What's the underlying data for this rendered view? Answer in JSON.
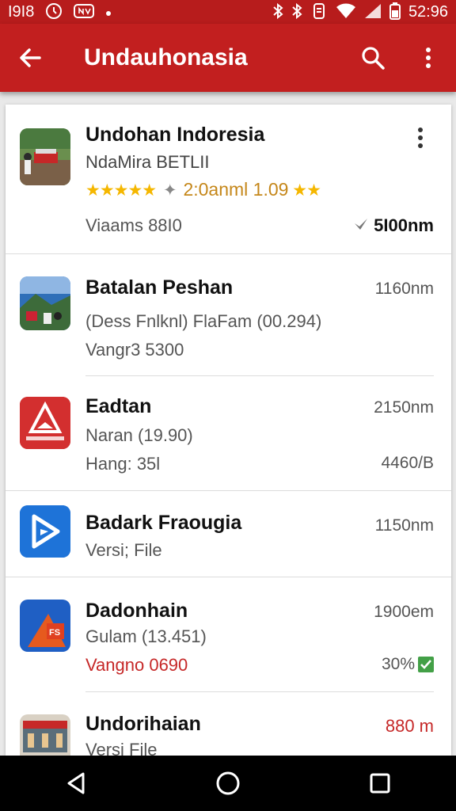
{
  "status_bar": {
    "time_left": "I9I8",
    "time_right": "52:96",
    "icons": [
      "clock-circle-icon",
      "nfc-icon",
      "dot-icon",
      "bluetooth-icon",
      "bluetooth-alt-icon",
      "vibrate-icon",
      "wifi-icon",
      "signal-icon",
      "battery-icon"
    ]
  },
  "toolbar": {
    "title": "Undauhonasia",
    "back_icon": "arrow-left-icon",
    "search_icon": "search-icon",
    "menu_icon": "more-vert-icon"
  },
  "featured": {
    "title": "Undohan Indoresia",
    "subtitle": "NdaMira BETLII",
    "rating_text": "2:0anml 1.09",
    "meta": "Viaams 88I0",
    "size": "5I00nm"
  },
  "items": [
    {
      "title": "Batalan Peshan",
      "sub1": "(Dess Fnlknl) FlaFam (00.294)",
      "sub2": "Vangr3 5300",
      "right1": "1160nm",
      "right2": ""
    },
    {
      "title": "Eadtan",
      "sub1": "Naran (19.90)",
      "sub2": "Hang: 35l",
      "right1": "2150nm",
      "right2": "4460/B"
    },
    {
      "title": "Badark Fraougia",
      "sub1": "Versi; File",
      "sub2": "",
      "right1": "1150nm",
      "right2": ""
    },
    {
      "title": "Dadonhain",
      "sub1": "Gulam (13.451)",
      "sub2": "Vangno 0690",
      "right1": "1900em",
      "right2": "30%"
    },
    {
      "title": "Undorihaian",
      "sub1": "Versi File",
      "sub2": "",
      "right1": "880 m",
      "right2": ""
    }
  ],
  "colors": {
    "primary": "#c21f1f",
    "status": "#b71c1c",
    "accent_red": "#c62828",
    "star": "#f5b700",
    "check": "#43a047"
  },
  "nav": {
    "back_icon": "nav-back-icon",
    "home_icon": "nav-home-icon",
    "recents_icon": "nav-recents-icon"
  }
}
